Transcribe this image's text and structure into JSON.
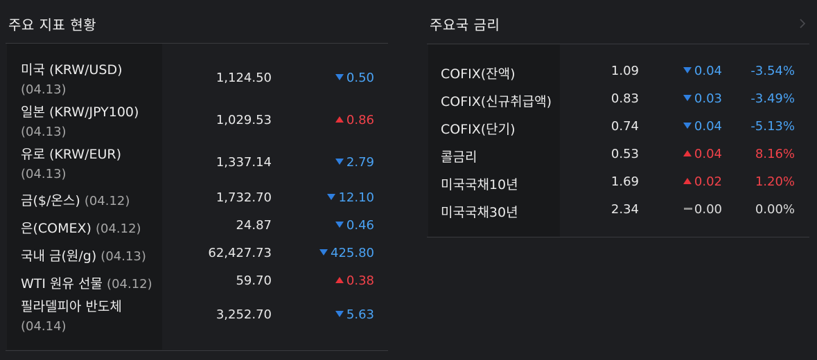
{
  "indicators": {
    "title": "주요 지표 현황",
    "rows": [
      {
        "name": "미국 (KRW/USD)",
        "date": "(04.13)",
        "value": "1,124.50",
        "dir": "down",
        "change": "0.50"
      },
      {
        "name": "일본 (KRW/JPY100)",
        "date": "(04.13)",
        "value": "1,029.53",
        "dir": "up",
        "change": "0.86"
      },
      {
        "name": "유로 (KRW/EUR)",
        "date": "(04.13)",
        "value": "1,337.14",
        "dir": "down",
        "change": "2.79"
      },
      {
        "name": "금($/온스)",
        "date": "(04.12)",
        "value": "1,732.70",
        "dir": "down",
        "change": "12.10"
      },
      {
        "name": "은(COMEX)",
        "date": "(04.12)",
        "value": "24.87",
        "dir": "down",
        "change": "0.46"
      },
      {
        "name": "국내 금(원/g)",
        "date": "(04.13)",
        "value": "62,427.73",
        "dir": "down",
        "change": "425.80"
      },
      {
        "name": "WTI 원유 선물",
        "date": "(04.12)",
        "value": "59.70",
        "dir": "up",
        "change": "0.38"
      },
      {
        "name": "필라델피아 반도체",
        "date": "(04.14)",
        "value": "3,252.70",
        "dir": "down",
        "change": "5.63"
      }
    ]
  },
  "rates": {
    "title": "주요국 금리",
    "rows": [
      {
        "name": "COFIX(잔액)",
        "value": "1.09",
        "dir": "down",
        "change": "0.04",
        "pct": "-3.54%"
      },
      {
        "name": "COFIX(신규취급액)",
        "value": "0.83",
        "dir": "down",
        "change": "0.03",
        "pct": "-3.49%"
      },
      {
        "name": "COFIX(단기)",
        "value": "0.74",
        "dir": "down",
        "change": "0.04",
        "pct": "-5.13%"
      },
      {
        "name": "콜금리",
        "value": "0.53",
        "dir": "up",
        "change": "0.04",
        "pct": "8.16%"
      },
      {
        "name": "미국국채10년",
        "value": "1.69",
        "dir": "up",
        "change": "0.02",
        "pct": "1.20%"
      },
      {
        "name": "미국국채30년",
        "value": "2.34",
        "dir": "flat",
        "change": "0.00",
        "pct": "0.00%"
      }
    ]
  },
  "icons": {
    "more": "chevron-right-icon",
    "down": "triangle-down-icon",
    "up": "triangle-up-icon",
    "flat": "dash-icon"
  },
  "colors": {
    "down": "#4aa3f5",
    "up": "#f2424a",
    "background": "#1d1e21"
  }
}
